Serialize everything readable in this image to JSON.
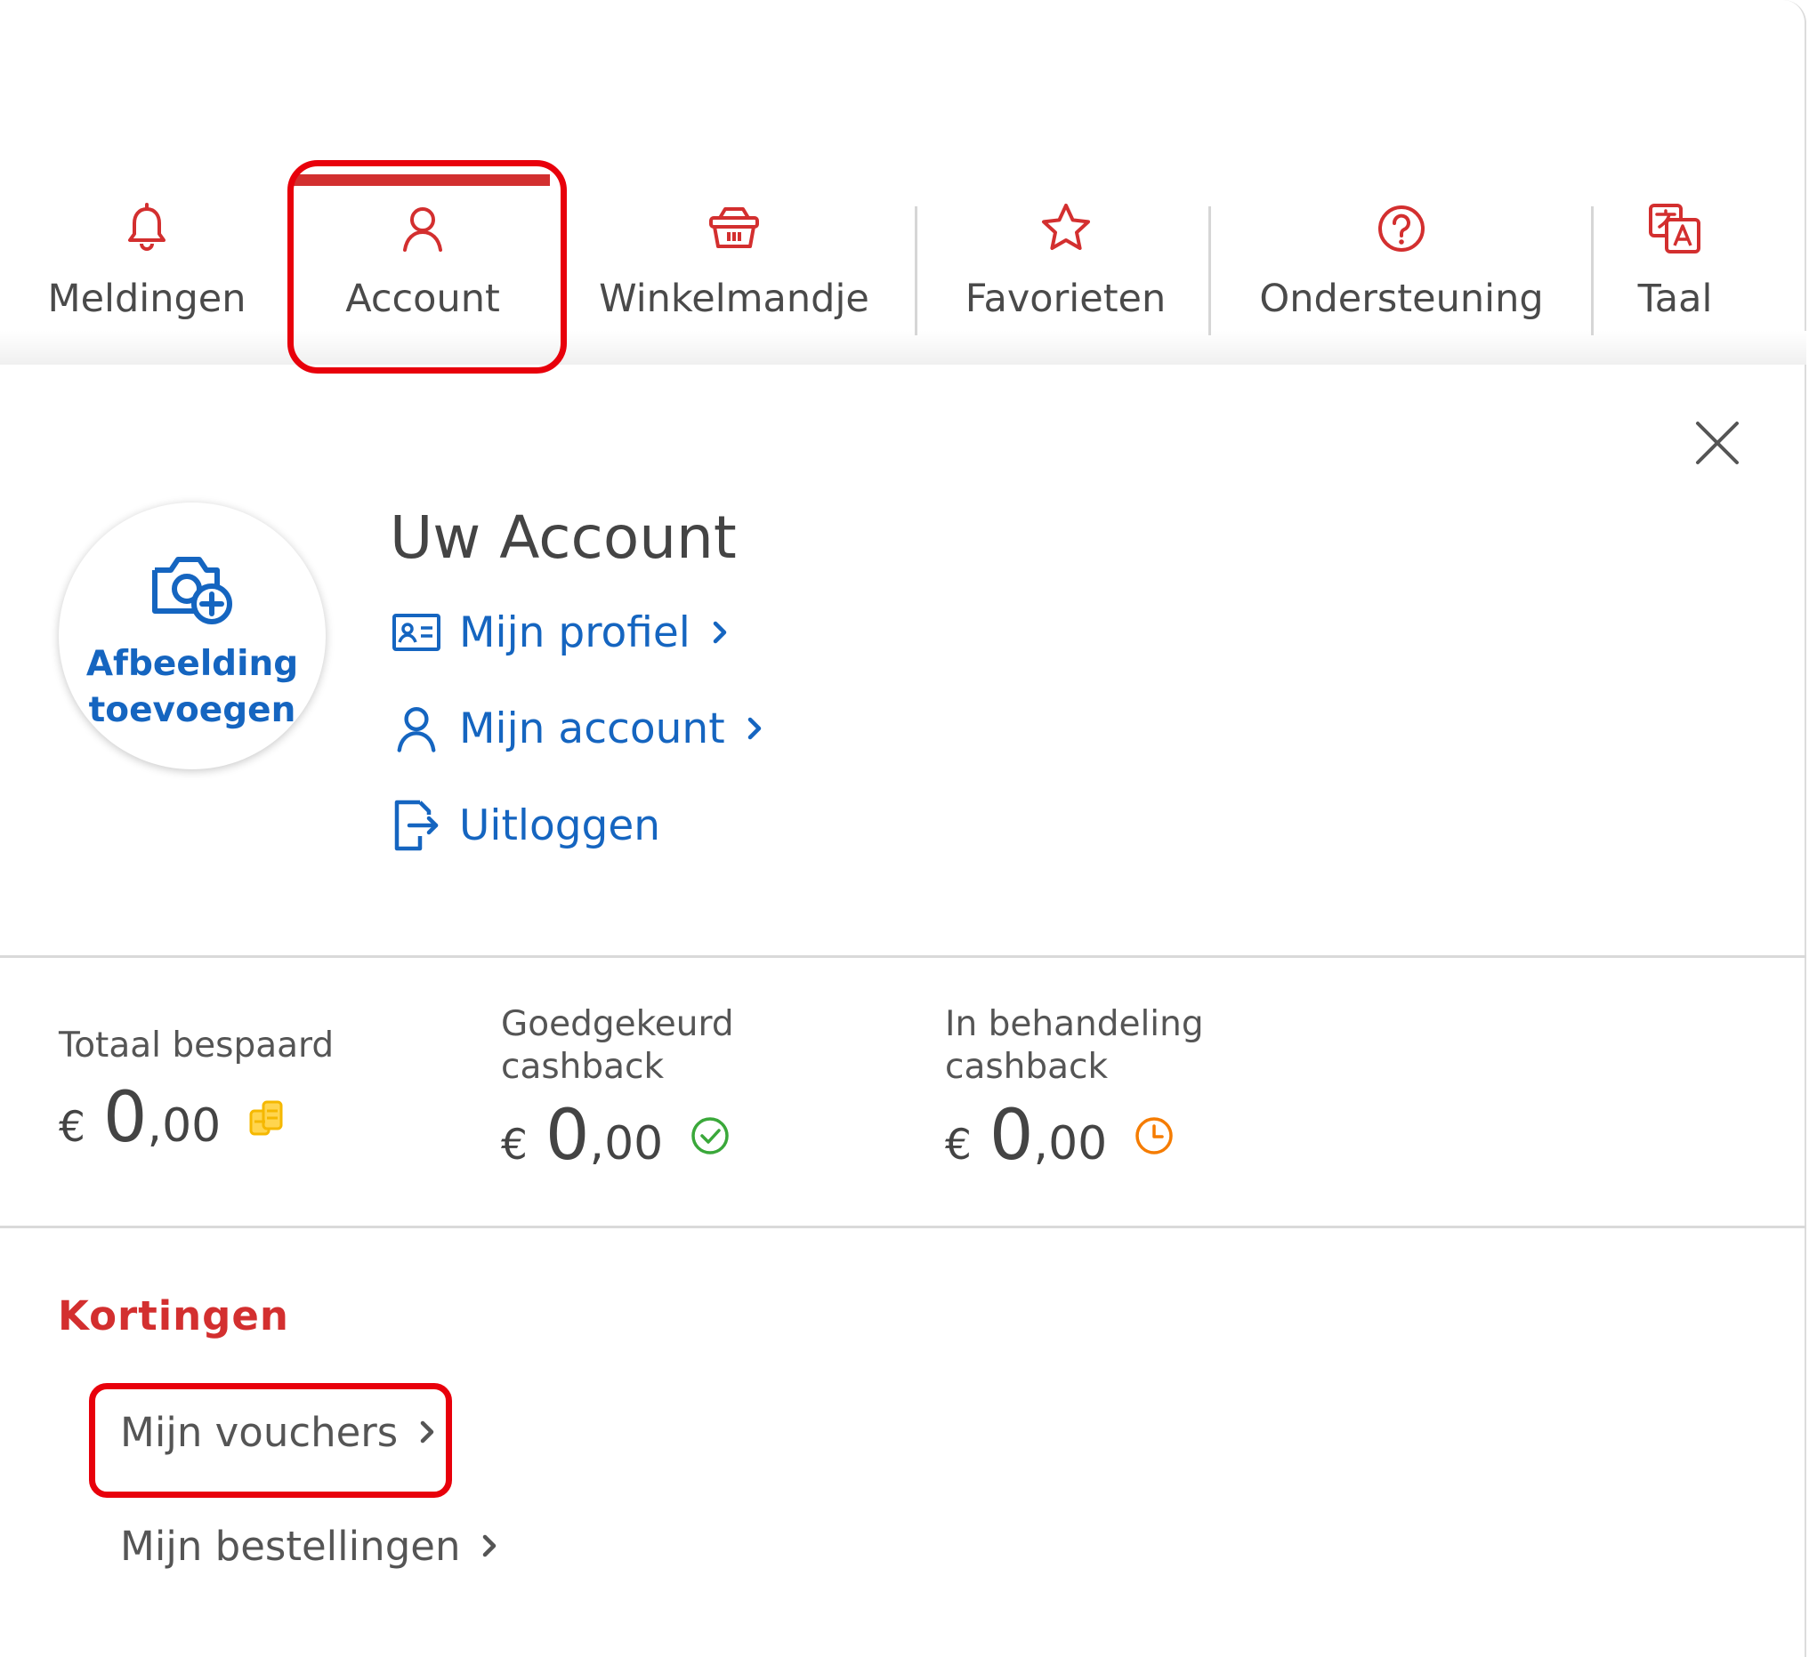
{
  "nav": {
    "items": [
      {
        "label": "Meldingen",
        "icon": "bell-icon"
      },
      {
        "label": "Account",
        "icon": "user-icon"
      },
      {
        "label": "Winkelmandje",
        "icon": "basket-icon"
      },
      {
        "label": "Favorieten",
        "icon": "star-icon"
      },
      {
        "label": "Ondersteuning",
        "icon": "question-circle-icon"
      },
      {
        "label": "Taal",
        "icon": "translate-icon"
      }
    ],
    "active": "Account",
    "accent_color": "#d32f2f"
  },
  "account": {
    "title": "Uw Account",
    "avatar_label_line1": "Afbeelding",
    "avatar_label_line2": "toevoegen",
    "links": [
      {
        "label": "Mijn profiel",
        "icon": "id-card-icon"
      },
      {
        "label": "Mijn account",
        "icon": "user-icon"
      },
      {
        "label": "Uitloggen",
        "icon": "logout-icon"
      }
    ],
    "link_color": "#1565c0"
  },
  "stats": [
    {
      "label_line1": "Totaal bespaard",
      "label_line2": "",
      "currency": "€",
      "integer": "0",
      "decimal": ",00",
      "icon": "coins-icon",
      "icon_color": "#f5b800"
    },
    {
      "label_line1": "Goedgekeurd",
      "label_line2": "cashback",
      "currency": "€",
      "integer": "0",
      "decimal": ",00",
      "icon": "check-circle-icon",
      "icon_color": "#3aa83a"
    },
    {
      "label_line1": "In behandeling",
      "label_line2": "cashback",
      "currency": "€",
      "integer": "0",
      "decimal": ",00",
      "icon": "clock-icon",
      "icon_color": "#f57c00"
    }
  ],
  "kortingen": {
    "title": "Kortingen",
    "links": [
      {
        "label": "Mijn vouchers"
      },
      {
        "label": "Mijn bestellingen"
      }
    ]
  },
  "highlight_color": "#e8000b"
}
